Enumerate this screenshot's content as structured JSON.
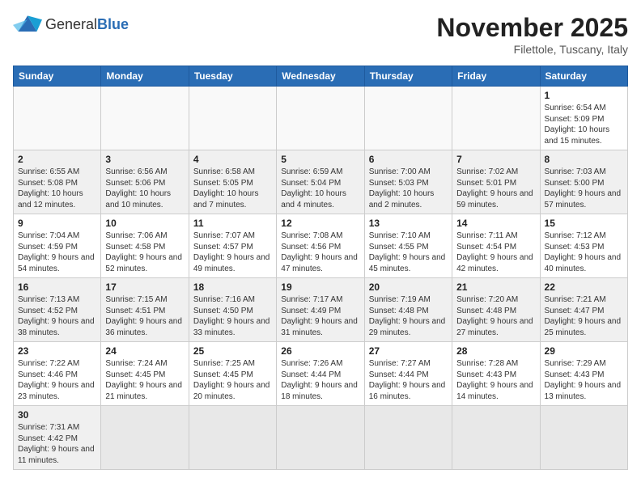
{
  "header": {
    "logo_general": "General",
    "logo_blue": "Blue",
    "month_title": "November 2025",
    "location": "Filettole, Tuscany, Italy"
  },
  "days_of_week": [
    "Sunday",
    "Monday",
    "Tuesday",
    "Wednesday",
    "Thursday",
    "Friday",
    "Saturday"
  ],
  "weeks": [
    [
      null,
      null,
      null,
      null,
      null,
      null,
      {
        "day": "1",
        "sunrise": "6:54 AM",
        "sunset": "5:09 PM",
        "daylight": "10 hours and 15 minutes."
      }
    ],
    [
      {
        "day": "2",
        "sunrise": "6:55 AM",
        "sunset": "5:08 PM",
        "daylight": "10 hours and 12 minutes."
      },
      {
        "day": "3",
        "sunrise": "6:56 AM",
        "sunset": "5:06 PM",
        "daylight": "10 hours and 10 minutes."
      },
      {
        "day": "4",
        "sunrise": "6:58 AM",
        "sunset": "5:05 PM",
        "daylight": "10 hours and 7 minutes."
      },
      {
        "day": "5",
        "sunrise": "6:59 AM",
        "sunset": "5:04 PM",
        "daylight": "10 hours and 4 minutes."
      },
      {
        "day": "6",
        "sunrise": "7:00 AM",
        "sunset": "5:03 PM",
        "daylight": "10 hours and 2 minutes."
      },
      {
        "day": "7",
        "sunrise": "7:02 AM",
        "sunset": "5:01 PM",
        "daylight": "9 hours and 59 minutes."
      },
      {
        "day": "8",
        "sunrise": "7:03 AM",
        "sunset": "5:00 PM",
        "daylight": "9 hours and 57 minutes."
      }
    ],
    [
      {
        "day": "9",
        "sunrise": "7:04 AM",
        "sunset": "4:59 PM",
        "daylight": "9 hours and 54 minutes."
      },
      {
        "day": "10",
        "sunrise": "7:06 AM",
        "sunset": "4:58 PM",
        "daylight": "9 hours and 52 minutes."
      },
      {
        "day": "11",
        "sunrise": "7:07 AM",
        "sunset": "4:57 PM",
        "daylight": "9 hours and 49 minutes."
      },
      {
        "day": "12",
        "sunrise": "7:08 AM",
        "sunset": "4:56 PM",
        "daylight": "9 hours and 47 minutes."
      },
      {
        "day": "13",
        "sunrise": "7:10 AM",
        "sunset": "4:55 PM",
        "daylight": "9 hours and 45 minutes."
      },
      {
        "day": "14",
        "sunrise": "7:11 AM",
        "sunset": "4:54 PM",
        "daylight": "9 hours and 42 minutes."
      },
      {
        "day": "15",
        "sunrise": "7:12 AM",
        "sunset": "4:53 PM",
        "daylight": "9 hours and 40 minutes."
      }
    ],
    [
      {
        "day": "16",
        "sunrise": "7:13 AM",
        "sunset": "4:52 PM",
        "daylight": "9 hours and 38 minutes."
      },
      {
        "day": "17",
        "sunrise": "7:15 AM",
        "sunset": "4:51 PM",
        "daylight": "9 hours and 36 minutes."
      },
      {
        "day": "18",
        "sunrise": "7:16 AM",
        "sunset": "4:50 PM",
        "daylight": "9 hours and 33 minutes."
      },
      {
        "day": "19",
        "sunrise": "7:17 AM",
        "sunset": "4:49 PM",
        "daylight": "9 hours and 31 minutes."
      },
      {
        "day": "20",
        "sunrise": "7:19 AM",
        "sunset": "4:48 PM",
        "daylight": "9 hours and 29 minutes."
      },
      {
        "day": "21",
        "sunrise": "7:20 AM",
        "sunset": "4:48 PM",
        "daylight": "9 hours and 27 minutes."
      },
      {
        "day": "22",
        "sunrise": "7:21 AM",
        "sunset": "4:47 PM",
        "daylight": "9 hours and 25 minutes."
      }
    ],
    [
      {
        "day": "23",
        "sunrise": "7:22 AM",
        "sunset": "4:46 PM",
        "daylight": "9 hours and 23 minutes."
      },
      {
        "day": "24",
        "sunrise": "7:24 AM",
        "sunset": "4:45 PM",
        "daylight": "9 hours and 21 minutes."
      },
      {
        "day": "25",
        "sunrise": "7:25 AM",
        "sunset": "4:45 PM",
        "daylight": "9 hours and 20 minutes."
      },
      {
        "day": "26",
        "sunrise": "7:26 AM",
        "sunset": "4:44 PM",
        "daylight": "9 hours and 18 minutes."
      },
      {
        "day": "27",
        "sunrise": "7:27 AM",
        "sunset": "4:44 PM",
        "daylight": "9 hours and 16 minutes."
      },
      {
        "day": "28",
        "sunrise": "7:28 AM",
        "sunset": "4:43 PM",
        "daylight": "9 hours and 14 minutes."
      },
      {
        "day": "29",
        "sunrise": "7:29 AM",
        "sunset": "4:43 PM",
        "daylight": "9 hours and 13 minutes."
      }
    ],
    [
      {
        "day": "30",
        "sunrise": "7:31 AM",
        "sunset": "4:42 PM",
        "daylight": "9 hours and 11 minutes."
      },
      null,
      null,
      null,
      null,
      null,
      null
    ]
  ]
}
